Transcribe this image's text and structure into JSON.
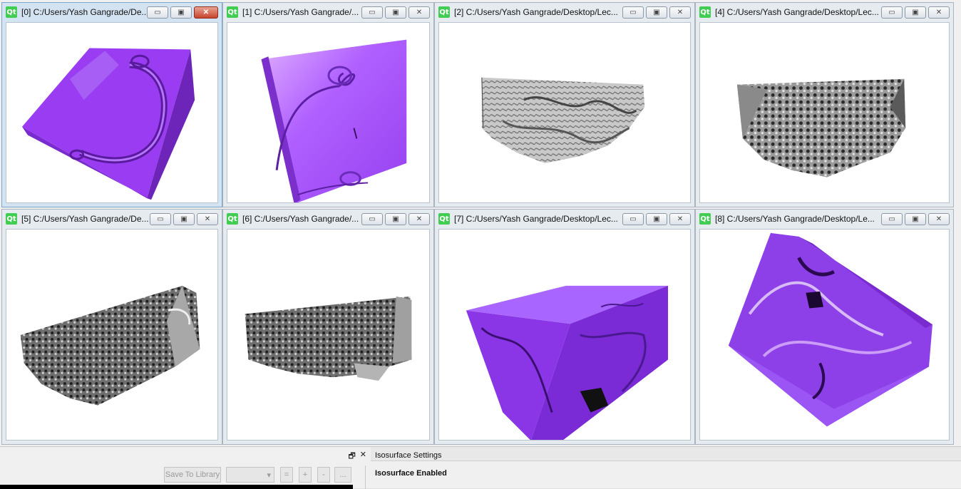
{
  "windows": [
    {
      "title": "[0] C:/Users/Yash Gangrade/De...",
      "active": true,
      "style": "purple-a"
    },
    {
      "title": "[1] C:/Users/Yash Gangrade/...",
      "active": false,
      "style": "purple-b"
    },
    {
      "title": "[2] C:/Users/Yash Gangrade/Desktop/Lec...",
      "active": false,
      "style": "gray-a"
    },
    {
      "title": "[4] C:/Users/Yash Gangrade/Desktop/Lec...",
      "active": false,
      "style": "gray-b"
    },
    {
      "title": "[5] C:/Users/Yash Gangrade/De...",
      "active": false,
      "style": "gray-c"
    },
    {
      "title": "[6] C:/Users/Yash Gangrade/...",
      "active": false,
      "style": "gray-d"
    },
    {
      "title": "[7] C:/Users/Yash Gangrade/Desktop/Lec...",
      "active": false,
      "style": "purple-c"
    },
    {
      "title": "[8] C:/Users/Yash Gangrade/Desktop/Le...",
      "active": false,
      "style": "purple-d"
    }
  ],
  "qt_logo": "Qt",
  "window_buttons": {
    "minimize": "▭",
    "maximize": "▣",
    "close": "✕"
  },
  "left_panel": {
    "dock_float": "🗗",
    "dock_close": "✕",
    "save_to_library": "Save To Library",
    "dropdown_value": "",
    "eq_button": "=",
    "plus_button": "+",
    "minus_button": "-",
    "more_button": "..."
  },
  "right_panel": {
    "title": "Isosurface Settings",
    "enabled_label": "Isosurface Enabled"
  },
  "colors": {
    "purple": "#9b3bf0",
    "purple_dark": "#6a1fb8",
    "purple_light": "#c68bff",
    "gray": "#b0b0b0",
    "gray_dark": "#3a3a3a"
  }
}
